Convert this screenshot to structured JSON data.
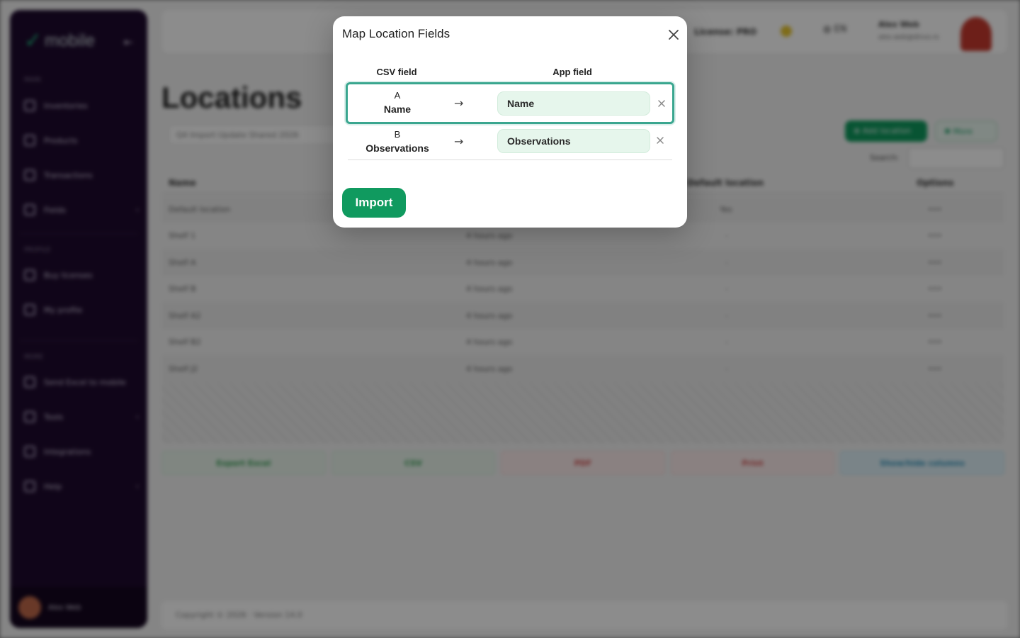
{
  "background": {
    "brand": "mobile",
    "sidebar": {
      "section_main": "Main",
      "items_main": [
        {
          "label": "Inventories"
        },
        {
          "label": "Products"
        },
        {
          "label": "Transactions"
        },
        {
          "label": "Fields"
        }
      ],
      "section_profile": "Profile",
      "items_profile": [
        {
          "label": "Buy licenses"
        },
        {
          "label": "My profile"
        }
      ],
      "section_more": "More",
      "items_more": [
        {
          "label": "Send Excel to mobile"
        },
        {
          "label": "Tools"
        },
        {
          "label": "Integrations"
        },
        {
          "label": "Help"
        }
      ],
      "user": "Alex Web"
    },
    "topbar": {
      "license": "License: PRO",
      "language": "EN",
      "user_name": "Alex Web",
      "user_email": "alex.web@dinvo.ro"
    },
    "page_title": "Locations",
    "file_label": "Q4 Import Update Shared 2026",
    "add_button": "Add location",
    "more_button": "More",
    "search_label": "Search:",
    "table": {
      "headers": [
        "Name",
        "Default location",
        "Options"
      ],
      "rows": [
        {
          "name": "Default location",
          "time": "",
          "default": "Yes"
        },
        {
          "name": "Shelf 1",
          "time": "4 hours ago",
          "default": "-"
        },
        {
          "name": "Shelf A",
          "time": "4 hours ago",
          "default": "-"
        },
        {
          "name": "Shelf B",
          "time": "4 hours ago",
          "default": "-"
        },
        {
          "name": "Shelf A2",
          "time": "4 hours ago",
          "default": "-"
        },
        {
          "name": "Shelf B2",
          "time": "4 hours ago",
          "default": "-"
        },
        {
          "name": "Shelf J2",
          "time": "4 hours ago",
          "default": "-"
        }
      ]
    },
    "bottom_buttons": [
      "Export Excel",
      "CSV",
      "PDF",
      "Print",
      "Show/hide columns"
    ],
    "footer": "Copyright © 2026 · Version 14.0"
  },
  "modal": {
    "title": "Map Location Fields",
    "csv_header": "CSV field",
    "app_header": "App field",
    "arrow": "→",
    "mappings": [
      {
        "csv_column": "A",
        "csv_name": "Name",
        "app_field": "Name"
      },
      {
        "csv_column": "B",
        "csv_name": "Observations",
        "app_field": "Observations"
      }
    ],
    "import_label": "Import"
  },
  "colors": {
    "accent_green": "#109a5f",
    "highlight_teal": "#3aa68f",
    "field_bg": "#e6f6ec",
    "sidebar_bg": "#1e0a2e"
  }
}
